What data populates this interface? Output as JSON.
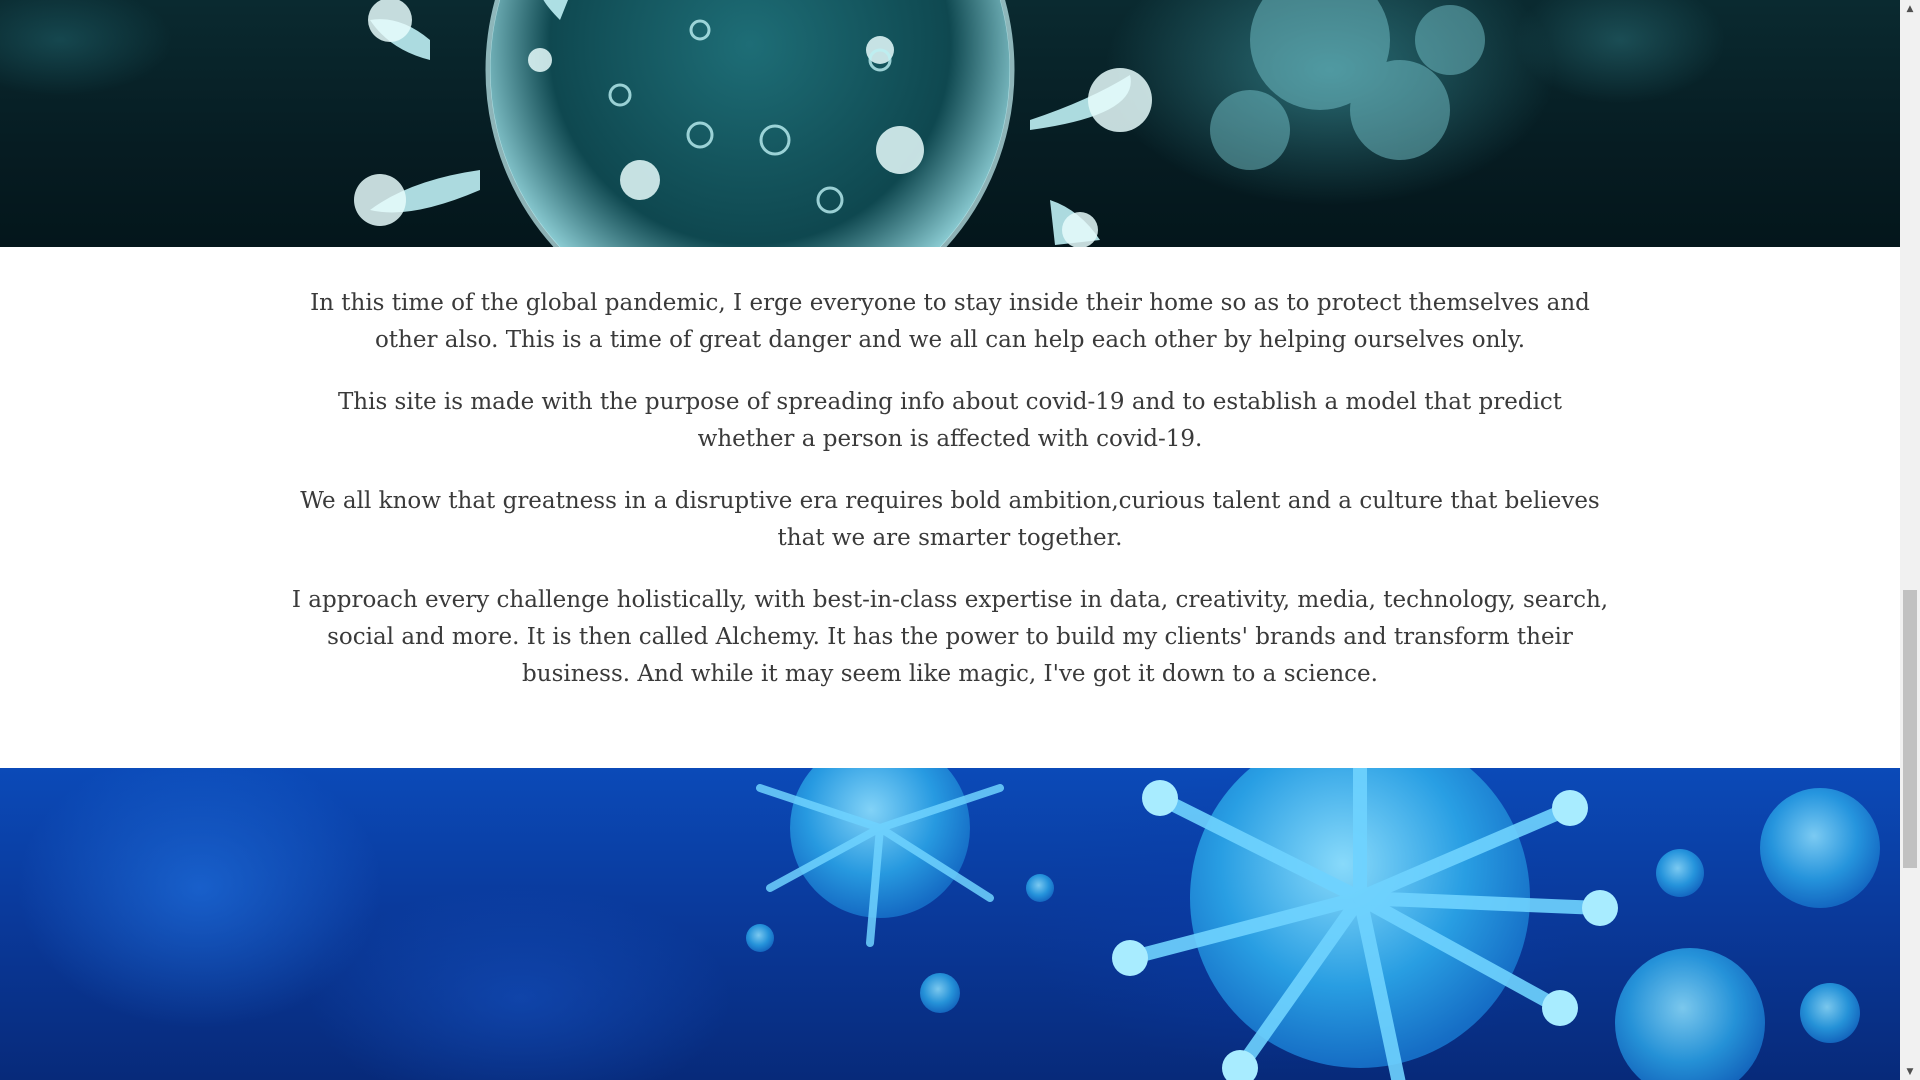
{
  "banners": {
    "top_image": "coronavirus-teal-image",
    "bottom_image": "coronavirus-blue-image"
  },
  "content": {
    "paragraphs": [
      "In this time of the global pandemic, I erge everyone to stay inside their home so as to protect themselves and other also. This is a time of great danger and we all can help each other by helping ourselves only.",
      "This site is made with the purpose of spreading info about covid-19 and to establish a model that predict whether a person is affected with covid-19.",
      "We all know that greatness in a disruptive era requires bold ambition,curious talent and a culture that believes that we are smarter together.",
      "I approach every challenge holistically, with best-in-class expertise in data, creativity, media, technology, search, social and more. It is then called Alchemy. It has the power to build my clients' brands and transform their business. And while it may seem like magic, I've got it down to a science."
    ]
  },
  "scrollbar": {
    "up_icon": "scroll-up-arrow-icon",
    "down_icon": "scroll-down-arrow-icon"
  },
  "colors": {
    "text": "#3a3a3a",
    "top_banner": "#061c22",
    "bottom_banner": "#0a3a9c"
  }
}
